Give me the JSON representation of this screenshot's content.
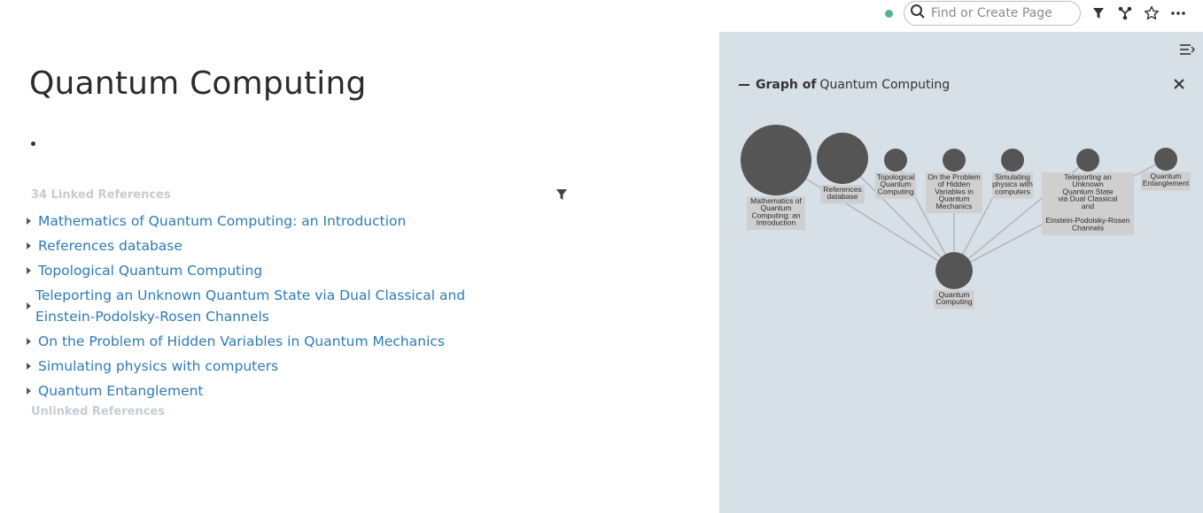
{
  "topbar": {
    "search_placeholder": "Find or Create Page",
    "icons": [
      "sync-status-dot",
      "search-icon",
      "filter-icon",
      "graph-icon",
      "star-icon",
      "more-icon"
    ]
  },
  "page": {
    "title": "Quantum Computing",
    "linked_refs_header": "34 Linked References",
    "unlinked_refs_header": "Unlinked References",
    "linked_refs": [
      "Mathematics of Quantum Computing: an Introduction",
      "References database",
      "Topological Quantum Computing",
      "Teleporting an Unknown Quantum State via Dual Classical and Einstein-Podolsky-Rosen Channels",
      "On the Problem of Hidden Variables in Quantum Mechanics",
      "Simulating physics with computers",
      "Quantum Entanglement"
    ]
  },
  "sidebar": {
    "graph_prefix": "Graph of",
    "graph_page": "Quantum Computing",
    "colors": {
      "background": "#d7dfe7",
      "node": "#555555",
      "label_bg": "#cfcfcf",
      "edge": "#b3b8bd"
    },
    "nodes": [
      {
        "id": "math",
        "label_lines": [
          "Mathematics of",
          "Quantum",
          "Computing: an",
          "Introduction"
        ]
      },
      {
        "id": "refs",
        "label_lines": [
          "References",
          "database"
        ]
      },
      {
        "id": "topo",
        "label_lines": [
          "Topological",
          "Quantum",
          "Computing"
        ]
      },
      {
        "id": "hidden",
        "label_lines": [
          "On the Problem",
          "of Hidden",
          "Variables in",
          "Quantum",
          "Mechanics"
        ]
      },
      {
        "id": "sim",
        "label_lines": [
          "Simulating",
          "physics with",
          "computers"
        ]
      },
      {
        "id": "tele",
        "label_lines": [
          "Teleporting an",
          "Unknown",
          "Quantum State",
          "via Dual Classical",
          "and",
          "",
          "Einstein-Podolsky-Rosen",
          "Channels"
        ]
      },
      {
        "id": "ent",
        "label_lines": [
          "Quantum",
          "Entanglement"
        ]
      },
      {
        "id": "center",
        "label_lines": [
          "Quantum",
          "Computing"
        ]
      }
    ]
  }
}
